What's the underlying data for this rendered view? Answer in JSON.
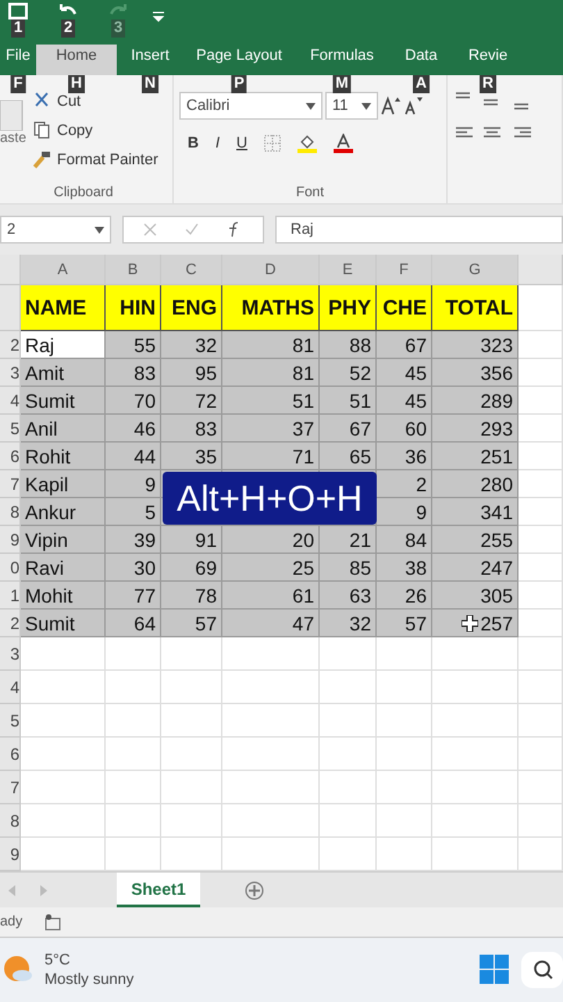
{
  "quick_access": [
    {
      "kind": "save",
      "keytip": "1"
    },
    {
      "kind": "undo",
      "keytip": "2"
    },
    {
      "kind": "redo",
      "keytip": "3",
      "disabled": true
    }
  ],
  "tabs": [
    {
      "label": "File",
      "keytip": "F",
      "selected": false
    },
    {
      "label": "Home",
      "keytip": "H",
      "selected": true
    },
    {
      "label": "Insert",
      "keytip": "N",
      "selected": false
    },
    {
      "label": "Page Layout",
      "keytip": "P",
      "selected": false
    },
    {
      "label": "Formulas",
      "keytip": "M",
      "selected": false
    },
    {
      "label": "Data",
      "keytip": "A",
      "selected": false
    },
    {
      "label": "Revie",
      "keytip": "R",
      "selected": false
    }
  ],
  "clipboard": {
    "paste": "aste",
    "items": [
      "Cut",
      "Copy",
      "Format Painter"
    ],
    "label": "Clipboard"
  },
  "font": {
    "name": "Calibri",
    "size": "11",
    "buttons": [
      "B",
      "I",
      "U"
    ],
    "label": "Font"
  },
  "formula_bar": {
    "name_box": "2",
    "value": "Raj"
  },
  "columns": [
    "A",
    "B",
    "C",
    "D",
    "E",
    "F",
    "G"
  ],
  "header": {
    "cells": [
      "NAME",
      "HIN",
      "ENG",
      "MATHS",
      "PHY",
      "CHE",
      "TOTAL"
    ]
  },
  "rows": [
    {
      "row_number": "2",
      "active": true,
      "cells": [
        "Raj",
        "55",
        "32",
        "81",
        "88",
        "67",
        "323"
      ]
    },
    {
      "row_number": "3",
      "active": false,
      "cells": [
        "Amit",
        "83",
        "95",
        "81",
        "52",
        "45",
        "356"
      ]
    },
    {
      "row_number": "4",
      "active": false,
      "cells": [
        "Sumit",
        "70",
        "72",
        "51",
        "51",
        "45",
        "289"
      ]
    },
    {
      "row_number": "5",
      "active": false,
      "cells": [
        "Anil",
        "46",
        "83",
        "37",
        "67",
        "60",
        "293"
      ]
    },
    {
      "row_number": "6",
      "active": false,
      "cells": [
        "Rohit",
        "44",
        "35",
        "71",
        "65",
        "36",
        "251"
      ]
    },
    {
      "row_number": "7",
      "active": false,
      "cells": [
        "Kapil",
        "9",
        null,
        null,
        null,
        "2",
        "280"
      ]
    },
    {
      "row_number": "8",
      "active": false,
      "cells": [
        "Ankur",
        "5",
        null,
        null,
        null,
        "9",
        "341"
      ]
    },
    {
      "row_number": "9",
      "active": false,
      "cells": [
        "Vipin",
        "39",
        "91",
        "20",
        "21",
        "84",
        "255"
      ]
    },
    {
      "row_number": "0",
      "active": false,
      "cells": [
        "Ravi",
        "30",
        "69",
        "25",
        "85",
        "38",
        "247"
      ]
    },
    {
      "row_number": "1",
      "active": false,
      "cells": [
        "Mohit",
        "77",
        "78",
        "61",
        "63",
        "26",
        "305"
      ]
    },
    {
      "row_number": "2",
      "active": false,
      "cells": [
        "Sumit",
        "64",
        "57",
        "47",
        "32",
        "57",
        "257"
      ]
    }
  ],
  "empty_rows": [
    "3",
    "4",
    "5",
    "6",
    "7",
    "8",
    "9"
  ],
  "shortcut_overlay": "Alt+H+O+H",
  "sheet_tabs": [
    {
      "label": "Sheet1",
      "selected": true
    }
  ],
  "status_bar": {
    "text": "ady"
  },
  "taskbar": {
    "temperature": "5°C",
    "weather": "Mostly sunny"
  }
}
